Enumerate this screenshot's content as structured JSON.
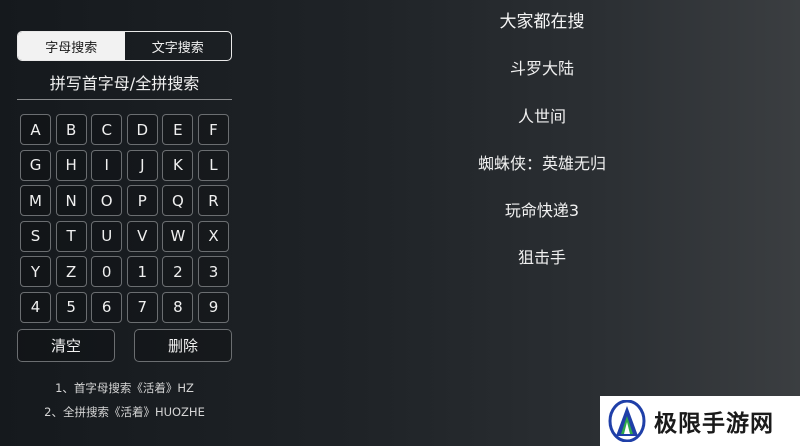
{
  "mode_tabs": [
    {
      "label": "字母搜索",
      "active": true
    },
    {
      "label": "文字搜索",
      "active": false
    }
  ],
  "search": {
    "placeholder": "拼写首字母/全拼搜索"
  },
  "keys": [
    "A",
    "B",
    "C",
    "D",
    "E",
    "F",
    "G",
    "H",
    "I",
    "J",
    "K",
    "L",
    "M",
    "N",
    "O",
    "P",
    "Q",
    "R",
    "S",
    "T",
    "U",
    "V",
    "W",
    "X",
    "Y",
    "Z",
    "0",
    "1",
    "2",
    "3",
    "4",
    "5",
    "6",
    "7",
    "8",
    "9"
  ],
  "actions": {
    "clear_label": "清空",
    "delete_label": "删除"
  },
  "tips": [
    "1、首字母搜索《活着》HZ",
    "2、全拼搜索《活着》HUOZHE"
  ],
  "hot": {
    "title": "大家都在搜",
    "items": [
      "斗罗大陆",
      "人世间",
      "蜘蛛侠：英雄无归",
      "玩命快递3",
      "狙击手"
    ]
  },
  "watermark": {
    "text": "极限手游网"
  }
}
